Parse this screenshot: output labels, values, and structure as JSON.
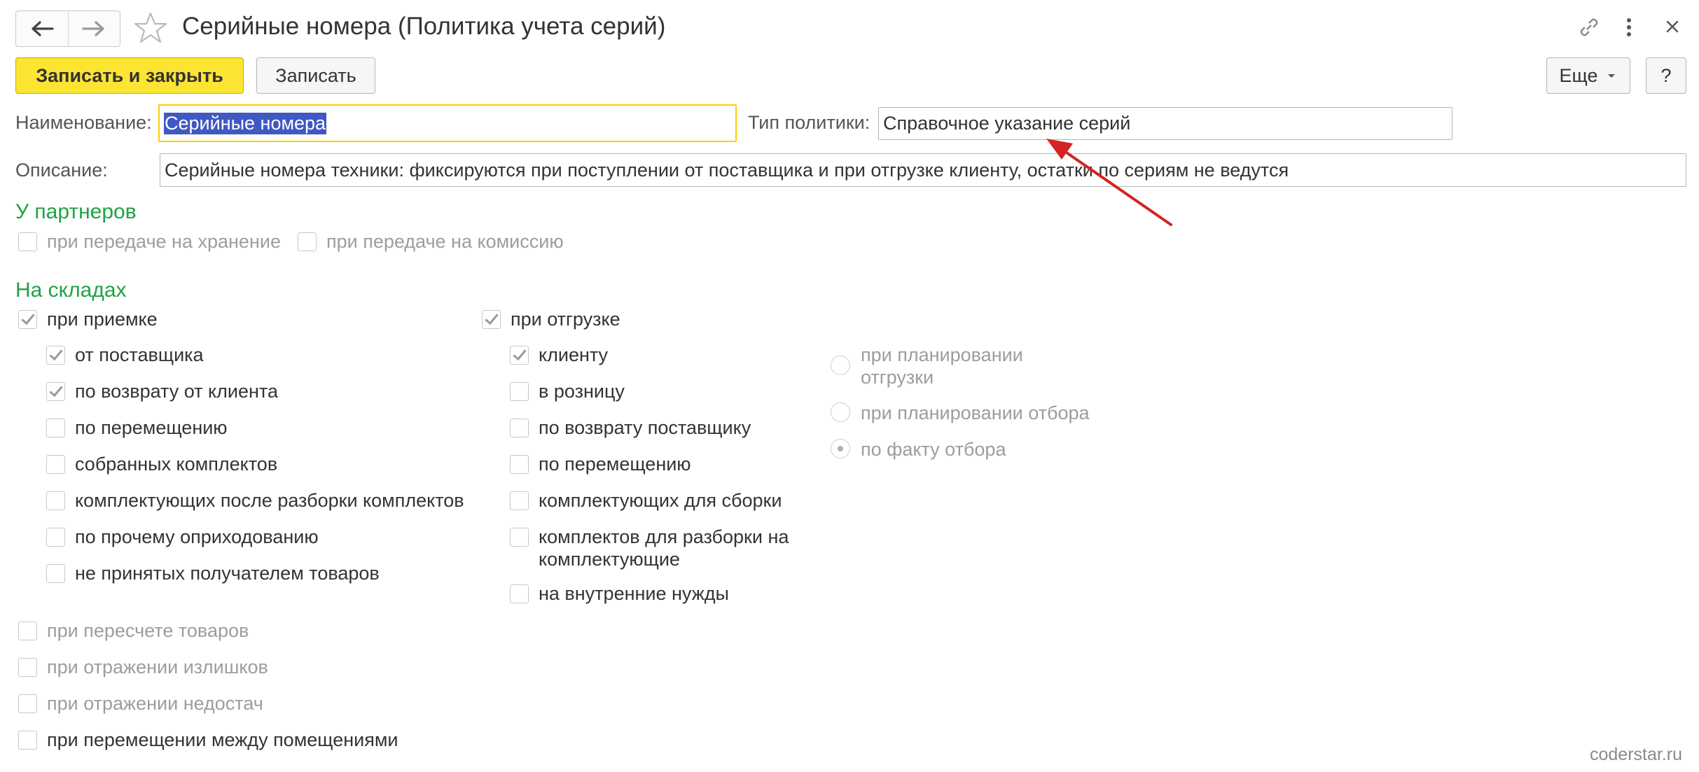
{
  "window": {
    "title": "Серийные номера (Политика учета серий)",
    "icons": [
      "arrow-left-icon",
      "arrow-right-icon",
      "star-icon",
      "link-icon",
      "more-vertical-icon",
      "close-icon"
    ]
  },
  "toolbar": {
    "save_close_label": "Записать и закрыть",
    "save_label": "Записать",
    "more_label": "Еще",
    "help_label": "?"
  },
  "form": {
    "name_label": "Наименование:",
    "name_value": "Серийные номера",
    "policy_type_label": "Тип политики:",
    "policy_type_value": "Справочное указание серий",
    "description_label": "Описание:",
    "description_value": "Серийные номера техники: фиксируются при поступлении от поставщика и при отгрузке клиенту, остатки по сериям не ведутся"
  },
  "partners": {
    "title": "У партнеров",
    "storage": {
      "label": "при передаче на хранение",
      "checked": false
    },
    "commission": {
      "label": "при передаче на комиссию",
      "checked": false
    }
  },
  "warehouses": {
    "title": "На складах",
    "receipt": {
      "label": "при приемке",
      "checked": true
    },
    "receipt_items": [
      {
        "label": "от поставщика",
        "checked": true
      },
      {
        "label": "по возврату от клиента",
        "checked": true
      },
      {
        "label": "по перемещению",
        "checked": false
      },
      {
        "label": "собранных комплектов",
        "checked": false
      },
      {
        "label": "комплектующих после разборки комплектов",
        "checked": false
      },
      {
        "label": "по прочему оприходованию",
        "checked": false
      },
      {
        "label": "не принятых получателем товаров",
        "checked": false
      }
    ],
    "shipment": {
      "label": "при отгрузке",
      "checked": true
    },
    "shipment_items": [
      {
        "label": "клиенту",
        "checked": true
      },
      {
        "label": "в розницу",
        "checked": false
      },
      {
        "label": "по возврату поставщику",
        "checked": false
      },
      {
        "label": "по перемещению",
        "checked": false
      },
      {
        "label": "комплектующих для сборки",
        "checked": false
      },
      {
        "label": "комплектов для разборки на комплектующие",
        "checked": false
      },
      {
        "label": "на внутренние нужды",
        "checked": false
      }
    ],
    "radio_options": [
      {
        "label": "при планировании отгрузки",
        "selected": false
      },
      {
        "label": "при планировании отбора",
        "selected": false
      },
      {
        "label": "по факту отбора",
        "selected": true
      }
    ],
    "bottom_items": [
      {
        "label": "при пересчете товаров",
        "checked": false
      },
      {
        "label": "при отражении излишков",
        "checked": false
      },
      {
        "label": "при отражении недостач",
        "checked": false
      },
      {
        "label": "при перемещении между помещениями",
        "checked": false
      }
    ]
  },
  "watermark": "coderstar.ru",
  "colors": {
    "primary_button": "#fbe432",
    "section_title": "#20a244",
    "selection": "#3f58c4",
    "focus_border": "#ffcc00",
    "annotation_arrow": "#d42424"
  }
}
